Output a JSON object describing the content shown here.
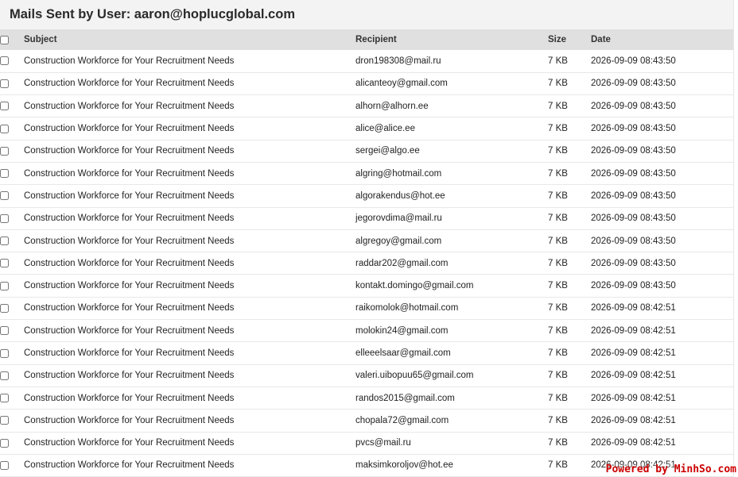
{
  "page": {
    "title": "Mails Sent by User: aaron@hoplucglobal.com"
  },
  "table": {
    "headers": {
      "subject": "Subject",
      "recipient": "Recipient",
      "size": "Size",
      "date": "Date"
    },
    "rows": [
      {
        "subject": "Construction Workforce for Your Recruitment Needs",
        "recipient": "dron198308@mail.ru",
        "size": "7 KB",
        "date": "2026-09-09 08:43:50"
      },
      {
        "subject": "Construction Workforce for Your Recruitment Needs",
        "recipient": "alicanteoy@gmail.com",
        "size": "7 KB",
        "date": "2026-09-09 08:43:50"
      },
      {
        "subject": "Construction Workforce for Your Recruitment Needs",
        "recipient": "alhorn@alhorn.ee",
        "size": "7 KB",
        "date": "2026-09-09 08:43:50"
      },
      {
        "subject": "Construction Workforce for Your Recruitment Needs",
        "recipient": "alice@alice.ee",
        "size": "7 KB",
        "date": "2026-09-09 08:43:50"
      },
      {
        "subject": "Construction Workforce for Your Recruitment Needs",
        "recipient": "sergei@algo.ee",
        "size": "7 KB",
        "date": "2026-09-09 08:43:50"
      },
      {
        "subject": "Construction Workforce for Your Recruitment Needs",
        "recipient": "algring@hotmail.com",
        "size": "7 KB",
        "date": "2026-09-09 08:43:50"
      },
      {
        "subject": "Construction Workforce for Your Recruitment Needs",
        "recipient": "algorakendus@hot.ee",
        "size": "7 KB",
        "date": "2026-09-09 08:43:50"
      },
      {
        "subject": "Construction Workforce for Your Recruitment Needs",
        "recipient": "jegorovdima@mail.ru",
        "size": "7 KB",
        "date": "2026-09-09 08:43:50"
      },
      {
        "subject": "Construction Workforce for Your Recruitment Needs",
        "recipient": "algregoy@gmail.com",
        "size": "7 KB",
        "date": "2026-09-09 08:43:50"
      },
      {
        "subject": "Construction Workforce for Your Recruitment Needs",
        "recipient": "raddar202@gmail.com",
        "size": "7 KB",
        "date": "2026-09-09 08:43:50"
      },
      {
        "subject": "Construction Workforce for Your Recruitment Needs",
        "recipient": "kontakt.domingo@gmail.com",
        "size": "7 KB",
        "date": "2026-09-09 08:43:50"
      },
      {
        "subject": "Construction Workforce for Your Recruitment Needs",
        "recipient": "raikomolok@hotmail.com",
        "size": "7 KB",
        "date": "2026-09-09 08:42:51"
      },
      {
        "subject": "Construction Workforce for Your Recruitment Needs",
        "recipient": "molokin24@gmail.com",
        "size": "7 KB",
        "date": "2026-09-09 08:42:51"
      },
      {
        "subject": "Construction Workforce for Your Recruitment Needs",
        "recipient": "elleeelsaar@gmail.com",
        "size": "7 KB",
        "date": "2026-09-09 08:42:51"
      },
      {
        "subject": "Construction Workforce for Your Recruitment Needs",
        "recipient": "valeri.uibopuu65@gmail.com",
        "size": "7 KB",
        "date": "2026-09-09 08:42:51"
      },
      {
        "subject": "Construction Workforce for Your Recruitment Needs",
        "recipient": "randos2015@gmail.com",
        "size": "7 KB",
        "date": "2026-09-09 08:42:51"
      },
      {
        "subject": "Construction Workforce for Your Recruitment Needs",
        "recipient": "chopala72@gmail.com",
        "size": "7 KB",
        "date": "2026-09-09 08:42:51"
      },
      {
        "subject": "Construction Workforce for Your Recruitment Needs",
        "recipient": "pvcs@mail.ru",
        "size": "7 KB",
        "date": "2026-09-09 08:42:51"
      },
      {
        "subject": "Construction Workforce for Your Recruitment Needs",
        "recipient": "maksimkoroljov@hot.ee",
        "size": "7 KB",
        "date": "2026-09-09 08:42:51"
      }
    ]
  },
  "watermark": {
    "text": "Powered by MinhSo.com",
    "color": "#cc0000"
  }
}
